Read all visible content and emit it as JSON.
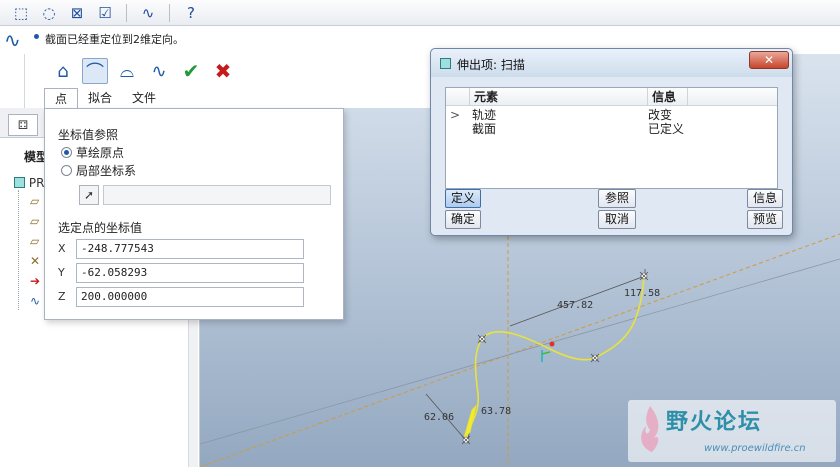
{
  "toolbar": {
    "icons": [
      "select-box-icon",
      "select-region-icon",
      "select-crossing-icon",
      "select-filter-icon",
      "sketch-display-icon",
      "whats-this-icon"
    ]
  },
  "message": {
    "text": "截面已经重定位到2维定向。"
  },
  "dashboard": {
    "tabs": [
      "点",
      "拟合",
      "文件"
    ],
    "active_tab": "点"
  },
  "model_tree": {
    "title": "模型",
    "root_label": "PR"
  },
  "point_panel": {
    "section_ref": "坐标值参照",
    "radio_sketch_origin": "草绘原点",
    "radio_local_csys": "局部坐标系",
    "section_coords": "选定点的坐标值",
    "x_label": "X",
    "x_value": "-248.777543",
    "y_label": "Y",
    "y_value": "-62.058293",
    "z_label": "Z",
    "z_value": "200.000000"
  },
  "dialog": {
    "title": "伸出项: 扫描",
    "col_element": "元素",
    "col_info": "信息",
    "rows": [
      {
        "marker": ">",
        "element": "轨迹",
        "info": "改变"
      },
      {
        "marker": "",
        "element": "截面",
        "info": "已定义"
      }
    ],
    "btn_define": "定义",
    "btn_reference": "参照",
    "btn_info": "信息",
    "btn_ok": "确定",
    "btn_cancel": "取消",
    "btn_preview": "预览"
  },
  "sketch": {
    "dim_length": "457.82",
    "dim_top": "117.58",
    "dim_left": "62.06",
    "dim_mid": "63.78"
  },
  "watermark": {
    "title": "野火论坛",
    "url": "www.proewildfire.cn"
  }
}
